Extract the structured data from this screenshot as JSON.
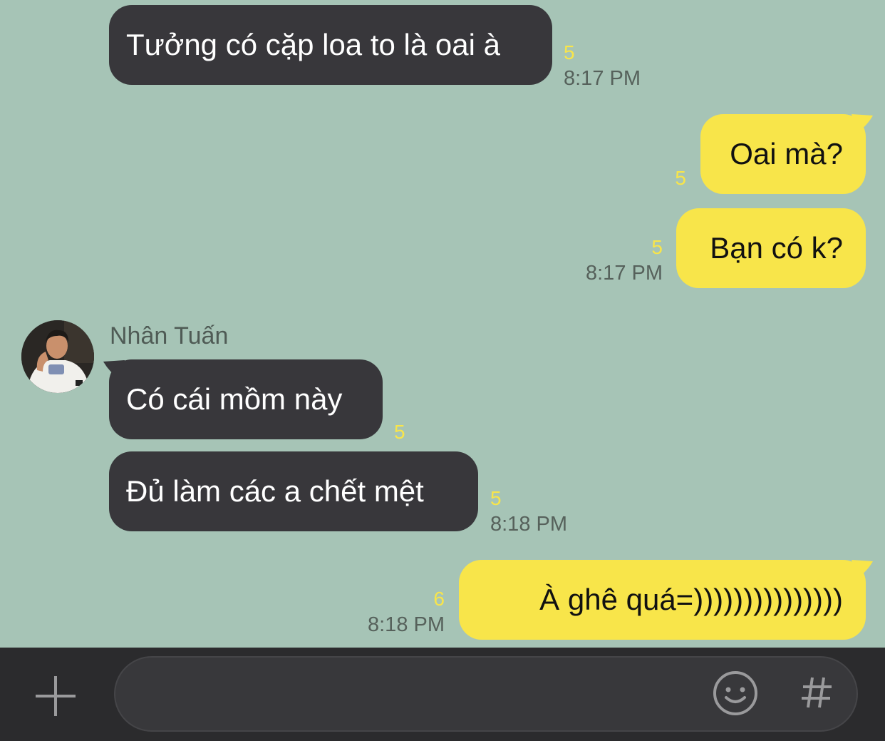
{
  "messages": [
    {
      "direction": "incoming",
      "text": "Tưởng có cặp loa to là oai à",
      "unread": "5",
      "time": "8:17 PM"
    },
    {
      "direction": "outgoing",
      "text": "Oai mà?",
      "unread": "5",
      "time": ""
    },
    {
      "direction": "outgoing",
      "text": "Bạn có k?",
      "unread": "5",
      "time": "8:17 PM"
    },
    {
      "direction": "incoming",
      "sender": "Nhân Tuấn",
      "text": "Có cái mồm này",
      "unread": "5",
      "time": ""
    },
    {
      "direction": "incoming",
      "text": "Đủ làm các a chết mệt",
      "unread": "5",
      "time": "8:18 PM"
    },
    {
      "direction": "outgoing",
      "text": "À ghê quá=)))))))))))))))",
      "unread": "6",
      "time": "8:18 PM"
    }
  ],
  "input_bar": {
    "message_value": "",
    "plus_icon": "plus-icon",
    "emoji_icon": "emoji-icon",
    "hashtag_icon": "hashtag-icon"
  },
  "colors": {
    "chat_background": "#a6c4b6",
    "incoming_bubble": "#38373b",
    "outgoing_bubble": "#f8e54a",
    "unread_count": "#f8e54a",
    "timestamp": "#56615b",
    "input_bar": "#2b2b2d"
  }
}
